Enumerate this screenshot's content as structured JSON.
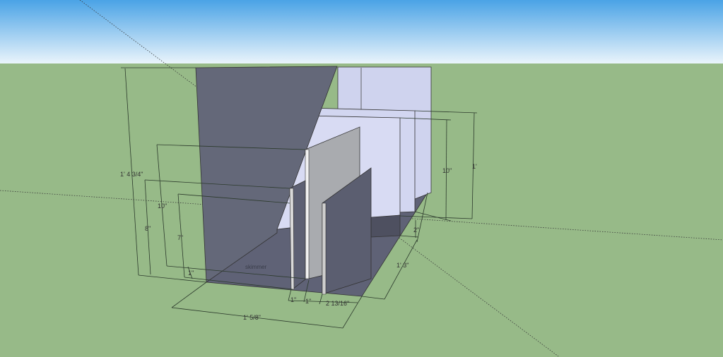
{
  "colors": {
    "sky_top": "#4aa3e6",
    "sky_bottom": "#eaf4fb",
    "ground": "#97ba88",
    "front_wall": "#646879",
    "glass_face": "#cfd3ee",
    "divider_gray": "#a9abaf",
    "dim_line": "#2c3a2c"
  },
  "labels": {
    "height_total": "1' 4 3/4\"",
    "height_10": "10\"",
    "height_8": "8\"",
    "height_7": "7\"",
    "height_small": "1\"",
    "right_10": "10\"",
    "right_1ft": "1'",
    "right_2": "2\"",
    "depth_1ft3": "1' 3\"",
    "width_total": "1' 5/8\"",
    "gap_1a": "1\"",
    "gap_1b": "1\"",
    "gap_2_13_16": "2 13/16\"",
    "skimmer": "skimmer"
  }
}
